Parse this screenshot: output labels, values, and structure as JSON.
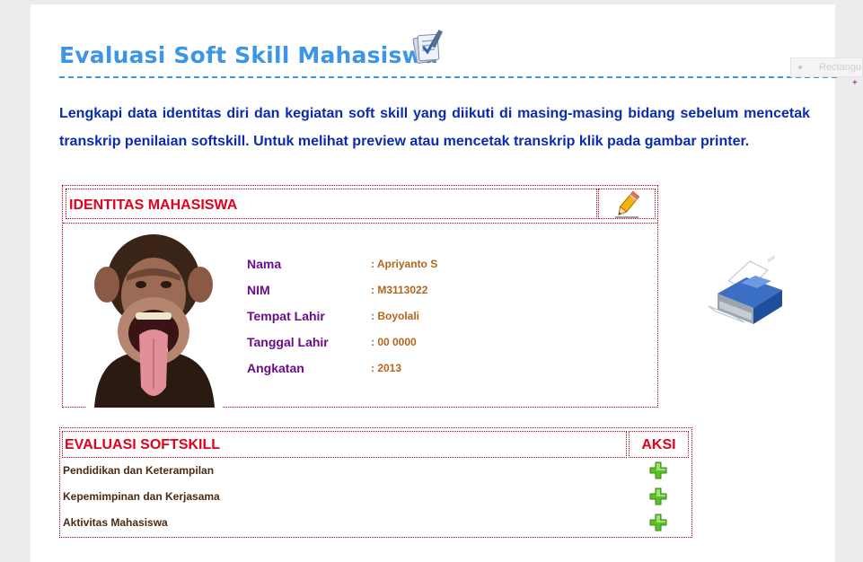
{
  "page": {
    "title": "Evaluasi Soft Skill Mahasiswa",
    "intro": "Lengkapi data identitas diri dan kegiatan soft skill yang diikuti di masing-masing bidang sebelum mencetak transkrip penilaian softskill. Untuk melihat preview atau mencetak transkrip klik pada gambar printer.",
    "title_icon": "clipboard-checklist-icon"
  },
  "ghost": {
    "label": "Rectangu"
  },
  "identity": {
    "heading": "IDENTITAS MAHASISWA",
    "edit_icon": "pencil-edit-icon",
    "photo": "student-photo-chimpanzee",
    "fields": [
      {
        "label": "Nama",
        "value": ": Apriyanto S"
      },
      {
        "label": "NIM",
        "value": ": M3113022"
      },
      {
        "label": "Tempat Lahir",
        "value": ": Boyolali"
      },
      {
        "label": "Tanggal Lahir",
        "value": ": 00 0000"
      },
      {
        "label": "Angkatan",
        "value": ": 2013"
      }
    ]
  },
  "printer_icon": "printer-icon",
  "evaluation": {
    "heading": "EVALUASI SOFTSKILL",
    "action_heading": "AKSI",
    "rows": [
      {
        "label": "Pendidikan dan Keterampilan",
        "action_icon": "add-plus-icon"
      },
      {
        "label": "Kepemimpinan dan Kerjasama",
        "action_icon": "add-plus-icon"
      },
      {
        "label": "Aktivitas Mahasiswa",
        "action_icon": "add-plus-icon"
      }
    ]
  },
  "colors": {
    "title": "#3d95e6",
    "intro": "#0a2bb0",
    "table_heading": "#e3001b",
    "field_label": "#6b0d8a",
    "field_value": "#b5651d",
    "border": "#b00020"
  }
}
